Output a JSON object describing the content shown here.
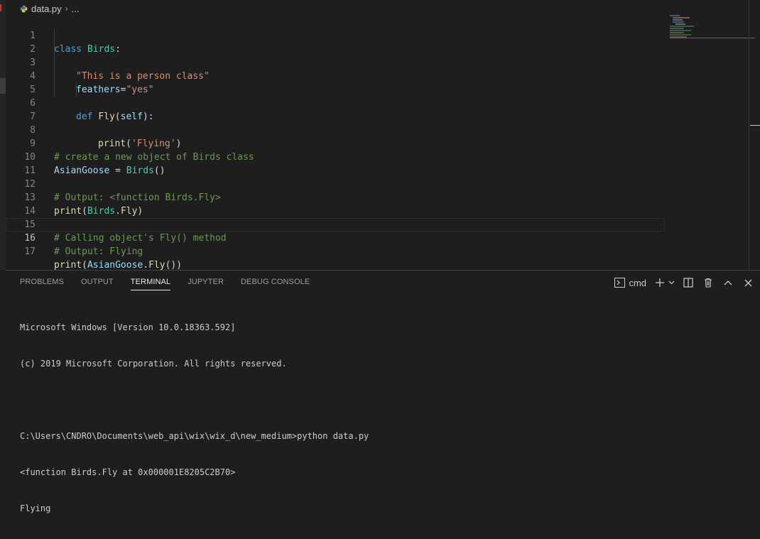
{
  "breadcrumb": {
    "file": "data.py",
    "more": "..."
  },
  "code_lines": [
    {
      "num": "1"
    },
    {
      "num": "2"
    },
    {
      "num": "3"
    },
    {
      "num": "4"
    },
    {
      "num": "5"
    },
    {
      "num": "6"
    },
    {
      "num": "7"
    },
    {
      "num": "8"
    },
    {
      "num": "9"
    },
    {
      "num": "10"
    },
    {
      "num": "11"
    },
    {
      "num": "12"
    },
    {
      "num": "13"
    },
    {
      "num": "14"
    },
    {
      "num": "15"
    },
    {
      "num": "16"
    },
    {
      "num": "17"
    }
  ],
  "code": {
    "l1": {
      "kw": "class",
      "name": "Birds",
      "colon": ":"
    },
    "l2": {
      "str": "\"This is a person class\""
    },
    "l3": {
      "var": "feathers",
      "eq": "=",
      "str": "\"yes\""
    },
    "l5": {
      "kw": "def",
      "fn": "Fly",
      "open": "(",
      "param": "self",
      "close": "):"
    },
    "l6": {
      "fn": "print",
      "open": "(",
      "str": "'Flying'",
      "close": ")"
    },
    "l9": {
      "comment": "# create a new object of Birds class"
    },
    "l10": {
      "var": "AsianGoose",
      "eq": " = ",
      "cls": "Birds",
      "parens": "()"
    },
    "l12": {
      "comment": "# Output: <function Birds.Fly>"
    },
    "l13": {
      "fn": "print",
      "open": "(",
      "cls": "Birds",
      "dot": ".",
      "attr": "Fly",
      "close": ")"
    },
    "l15": {
      "comment": "# Calling object's Fly() method"
    },
    "l16": {
      "comment": "# Output: Flying"
    },
    "l17": {
      "fn": "print",
      "open": "(",
      "var": "AsianGoose",
      "dot": ".",
      "attr": "Fly",
      "close": "())"
    }
  },
  "panel": {
    "tabs": [
      "PROBLEMS",
      "OUTPUT",
      "TERMINAL",
      "JUPYTER",
      "DEBUG CONSOLE"
    ],
    "active_tab": "TERMINAL",
    "terminal_name": "cmd"
  },
  "terminal_lines": [
    "Microsoft Windows [Version 10.0.18363.592]",
    "(c) 2019 Microsoft Corporation. All rights reserved.",
    "",
    "C:\\Users\\CNDRO\\Documents\\web_api\\wix\\wix_d\\new_medium>python data.py",
    "<function Birds.Fly at 0x000001E8205C2B70>",
    "Flying"
  ],
  "colors": {
    "keyword": "#569cd6",
    "class": "#4ec9b0",
    "string": "#ce9178",
    "variable": "#9cdcfe",
    "function": "#dcdcaa",
    "comment": "#6a9955"
  },
  "icons": [
    "python-file-icon",
    "terminal-icon",
    "plus-icon",
    "chevron-down-icon",
    "split-icon",
    "trash-icon",
    "maximize-icon",
    "close-icon"
  ]
}
